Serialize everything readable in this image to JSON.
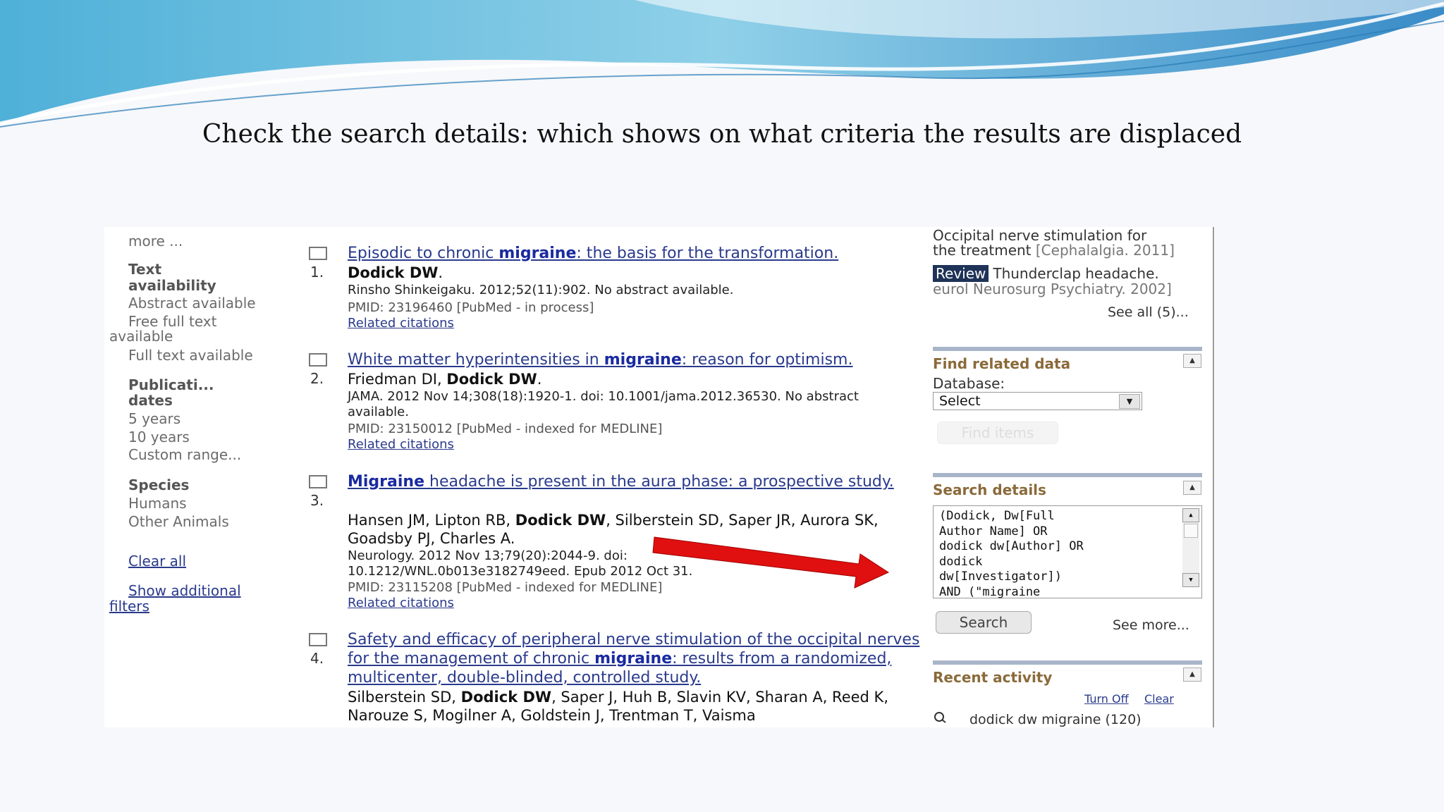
{
  "slide": {
    "title": "Check the search details: which shows on what criteria the results are displaced"
  },
  "filters": {
    "more": "more ...",
    "text_availability_heading": [
      "Text",
      "availability"
    ],
    "abstract_available": "Abstract available",
    "free_full_text": [
      "Free full text",
      "available"
    ],
    "full_text_available": "Full text available",
    "publication_dates_heading": [
      "Publicati...",
      "dates"
    ],
    "five_years": "5 years",
    "ten_years": "10 years",
    "custom_range": "Custom range...",
    "species_heading": "Species",
    "humans": "Humans",
    "other_animals": "Other Animals",
    "clear_all": "Clear all",
    "show_additional_filters": [
      "Show additional",
      "filters"
    ]
  },
  "results": [
    {
      "number": "1.",
      "title_parts": [
        "Episodic to chronic ",
        "migraine",
        ": the basis for the transformation."
      ],
      "authors_html_parts": [
        {
          "b": "Dodick DW"
        },
        {
          "t": "."
        }
      ],
      "journal": "Rinsho Shinkeigaku. 2012;52(11):902. No abstract available.",
      "pmid": "PMID: 23196460 [PubMed - in process]",
      "related": "Related citations"
    },
    {
      "number": "2.",
      "title_parts": [
        "White matter hyperintensities in ",
        "migraine",
        ": reason for optimism."
      ],
      "authors_html_parts": [
        {
          "t": "Friedman DI, "
        },
        {
          "b": "Dodick DW"
        },
        {
          "t": "."
        }
      ],
      "journal": "JAMA. 2012 Nov 14;308(18):1920-1. doi: 10.1001/jama.2012.36530. No abstract available.",
      "pmid": "PMID: 23150012 [PubMed - indexed for MEDLINE]",
      "related": "Related citations"
    },
    {
      "number": "3.",
      "title_parts": [
        "",
        "Migraine",
        " headache is present in the aura phase: a prospective study."
      ],
      "authors_html_parts": [
        {
          "t": "Hansen JM, Lipton RB, "
        },
        {
          "b": "Dodick DW"
        },
        {
          "t": ", Silberstein SD, Saper JR, Aurora SK, Goadsby PJ, Charles A."
        }
      ],
      "journal": "Neurology. 2012 Nov 13;79(20):2044-9. doi: 10.1212/WNL.0b013e3182749eed. Epub 2012 Oct 31.",
      "pmid": "PMID: 23115208 [PubMed - indexed for MEDLINE]",
      "related": "Related citations"
    },
    {
      "number": "4.",
      "title_parts": [
        "Safety and efficacy of peripheral nerve stimulation of the occipital nerves for the management of chronic ",
        "migraine",
        ": results from a randomized, multicenter, double-blinded, controlled study."
      ],
      "authors_html_parts": [
        {
          "t": "Silberstein SD, "
        },
        {
          "b": "Dodick DW"
        },
        {
          "t": ", Saper J, Huh B, Slavin KV, Sharan A, Reed K, Narouze S, Mogilner A, Goldstein J, Trentman T, Vaisma"
        }
      ],
      "journal": "",
      "pmid": "",
      "related": ""
    }
  ],
  "right": {
    "related_item1": [
      "Occipital nerve stimulation for",
      "the treatment "
    ],
    "related_item1_source": "[Cephalalgia. 2011]",
    "review_badge": "Review",
    "related_item2": "Thunderclap headache.",
    "related_item2_source": "eurol Neurosurg Psychiatry. 2002]",
    "see_all": "See all (5)...",
    "find_related_title": "Find related data",
    "database_label": "Database:",
    "database_select": "Select",
    "find_items": "Find items",
    "search_details_title": "Search details",
    "search_details_lines": [
      "(Dodick, Dw[Full",
      "Author Name] OR",
      "dodick dw[Author] OR",
      "dodick",
      "dw[Investigator])",
      "AND (\"migraine"
    ],
    "search_button": "Search",
    "see_more": "See more...",
    "recent_activity_title": "Recent activity",
    "turn_off": "Turn Off",
    "clear": "Clear",
    "recent_item": "dodick dw migraine (120)"
  },
  "colors": {
    "link": "#2a3a8c",
    "panel_title": "#8a6a3a",
    "arrow": "#e01010",
    "banner_light": "#bfe6f0",
    "banner_dark": "#4fa6d4"
  }
}
